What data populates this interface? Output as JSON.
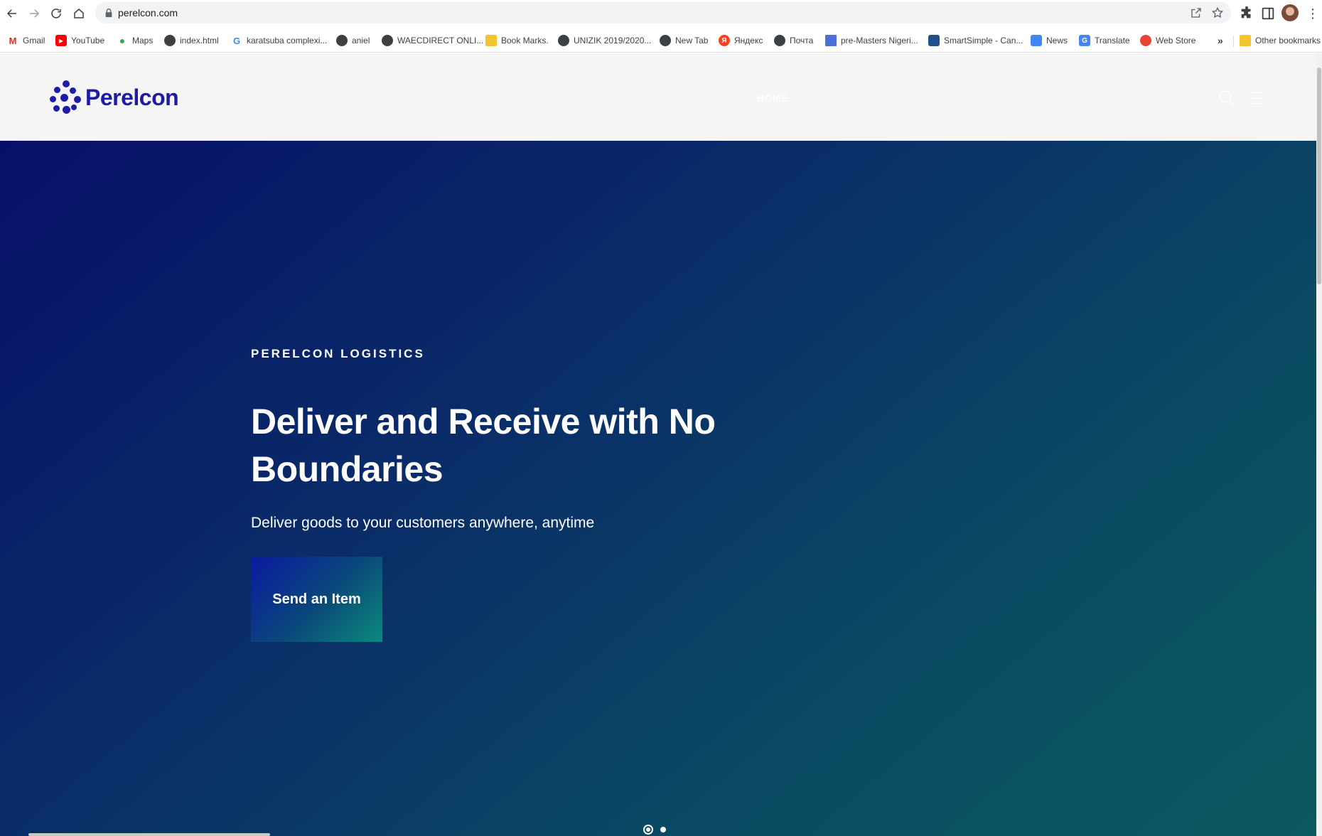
{
  "browser": {
    "url": "perelcon.com",
    "bookmarks": [
      {
        "label": "Gmail",
        "icon": "gmail-icon",
        "color": "#d93025"
      },
      {
        "label": "YouTube",
        "icon": "youtube-icon",
        "color": "#ff0000"
      },
      {
        "label": "Maps",
        "icon": "maps-icon",
        "color": "#34a853"
      },
      {
        "label": "index.html",
        "icon": "globe-icon",
        "color": "#3c4043"
      },
      {
        "label": "karatsuba complexi...",
        "icon": "google-icon",
        "color": "#4285f4"
      },
      {
        "label": "aniel",
        "icon": "globe-icon",
        "color": "#3c4043"
      },
      {
        "label": "WAECDIRECT ONLI...",
        "icon": "globe-icon",
        "color": "#3c4043"
      },
      {
        "label": "Book Marks.",
        "icon": "folder-icon",
        "color": "#f4c430"
      },
      {
        "label": "UNIZIK 2019/2020...",
        "icon": "globe-icon",
        "color": "#3c4043"
      },
      {
        "label": "New Tab",
        "icon": "globe-icon",
        "color": "#3c4043"
      },
      {
        "label": "Яндекс",
        "icon": "yandex-icon",
        "color": "#fc3f1d"
      },
      {
        "label": "Почта",
        "icon": "globe-icon",
        "color": "#3c4043"
      },
      {
        "label": "pre-Masters Nigeri...",
        "icon": "doc-icon",
        "color": "#4a6fd8"
      },
      {
        "label": "SmartSimple - Can...",
        "icon": "smartsimple-icon",
        "color": "#1f4e8c"
      },
      {
        "label": "News",
        "icon": "news-icon",
        "color": "#4285f4"
      },
      {
        "label": "Translate",
        "icon": "translate-icon",
        "color": "#4285f4"
      },
      {
        "label": "Web Store",
        "icon": "webstore-icon",
        "color": "#ea4335"
      }
    ],
    "more_bookmarks": "»",
    "other_bookmarks": "Other bookmarks"
  },
  "site": {
    "logo_text": "Perelcon",
    "nav": {
      "home": "HOME"
    }
  },
  "hero": {
    "eyebrow": "PERELCON LOGISTICS",
    "headline": "Deliver and Receive with No Boundaries",
    "subline": "Deliver goods to your customers anywhere, anytime",
    "cta": "Send an Item",
    "slides": 2,
    "active_slide": 1
  },
  "colors": {
    "brand": "#1d1ba8",
    "hero_start": "#071068",
    "hero_end": "#0b5a5f"
  }
}
